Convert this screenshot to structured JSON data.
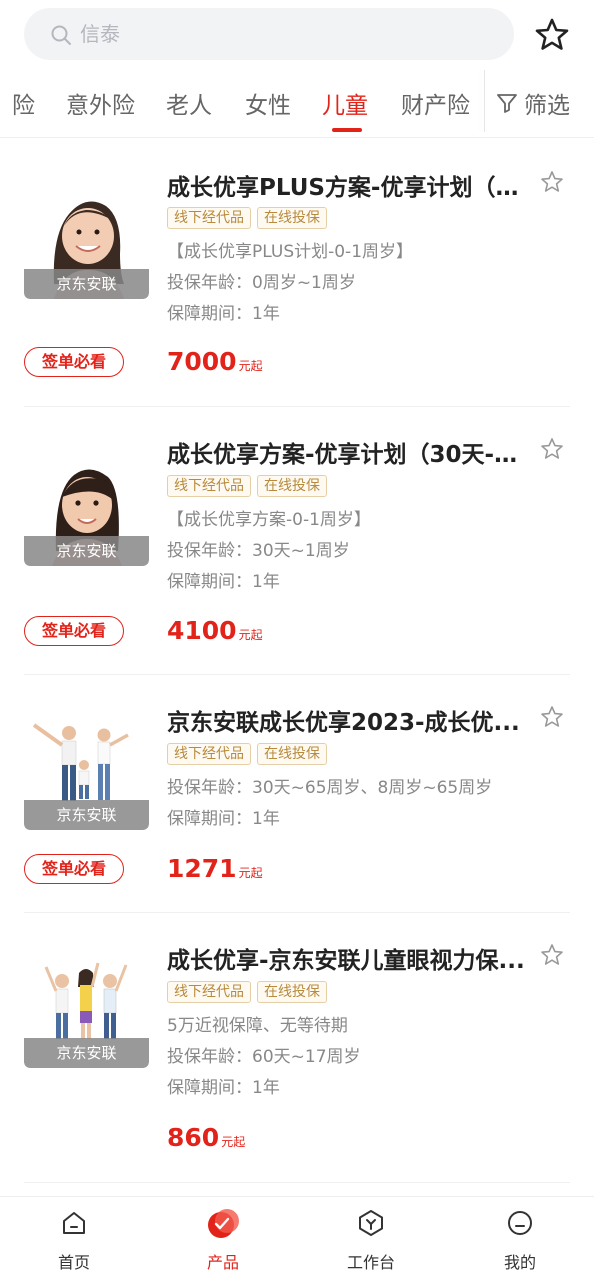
{
  "search": {
    "placeholder": "信泰"
  },
  "tabs": [
    {
      "label": "险"
    },
    {
      "label": "意外险"
    },
    {
      "label": "老人"
    },
    {
      "label": "女性"
    },
    {
      "label": "儿童",
      "active": true
    },
    {
      "label": "财产险"
    }
  ],
  "filter": {
    "label": "筛选"
  },
  "products": [
    {
      "title": "成长优享PLUS方案-优享计划（0...",
      "thumb_label": "京东安联",
      "tags": [
        "线下经代品",
        "在线投保"
      ],
      "lines": [
        "【成长优享PLUS计划-0-1周岁】",
        "投保年龄：0周岁~1周岁",
        "保障期间：1年"
      ],
      "must_read": "签单必看",
      "price": "7000",
      "price_unit": "元起"
    },
    {
      "title": "成长优享方案-优享计划（30天-1...",
      "thumb_label": "京东安联",
      "tags": [
        "线下经代品",
        "在线投保"
      ],
      "lines": [
        "【成长优享方案-0-1周岁】",
        "投保年龄：30天~1周岁",
        "保障期间：1年"
      ],
      "must_read": "签单必看",
      "price": "4100",
      "price_unit": "元起"
    },
    {
      "title": "京东安联成长优享2023-成长优...",
      "thumb_label": "京东安联",
      "tags": [
        "线下经代品",
        "在线投保"
      ],
      "lines": [
        "投保年龄：30天~65周岁、8周岁~65周岁",
        "保障期间：1年"
      ],
      "must_read": "签单必看",
      "price": "1271",
      "price_unit": "元起"
    },
    {
      "title": "成长优享-京东安联儿童眼视力保...",
      "thumb_label": "京东安联",
      "tags": [
        "线下经代品",
        "在线投保"
      ],
      "lines": [
        "5万近视保障、无等待期",
        "投保年龄：60天~17周岁",
        "保障期间：1年"
      ],
      "price": "860",
      "price_unit": "元起"
    }
  ],
  "bottom_nav": [
    {
      "label": "首页",
      "icon": "home-icon"
    },
    {
      "label": "产品",
      "icon": "product-icon",
      "active": true
    },
    {
      "label": "工作台",
      "icon": "workbench-icon"
    },
    {
      "label": "我的",
      "icon": "profile-icon"
    }
  ],
  "colors": {
    "accent": "#e2231a",
    "tag": "#b78a3d",
    "text": "#333333",
    "muted": "#888888"
  }
}
